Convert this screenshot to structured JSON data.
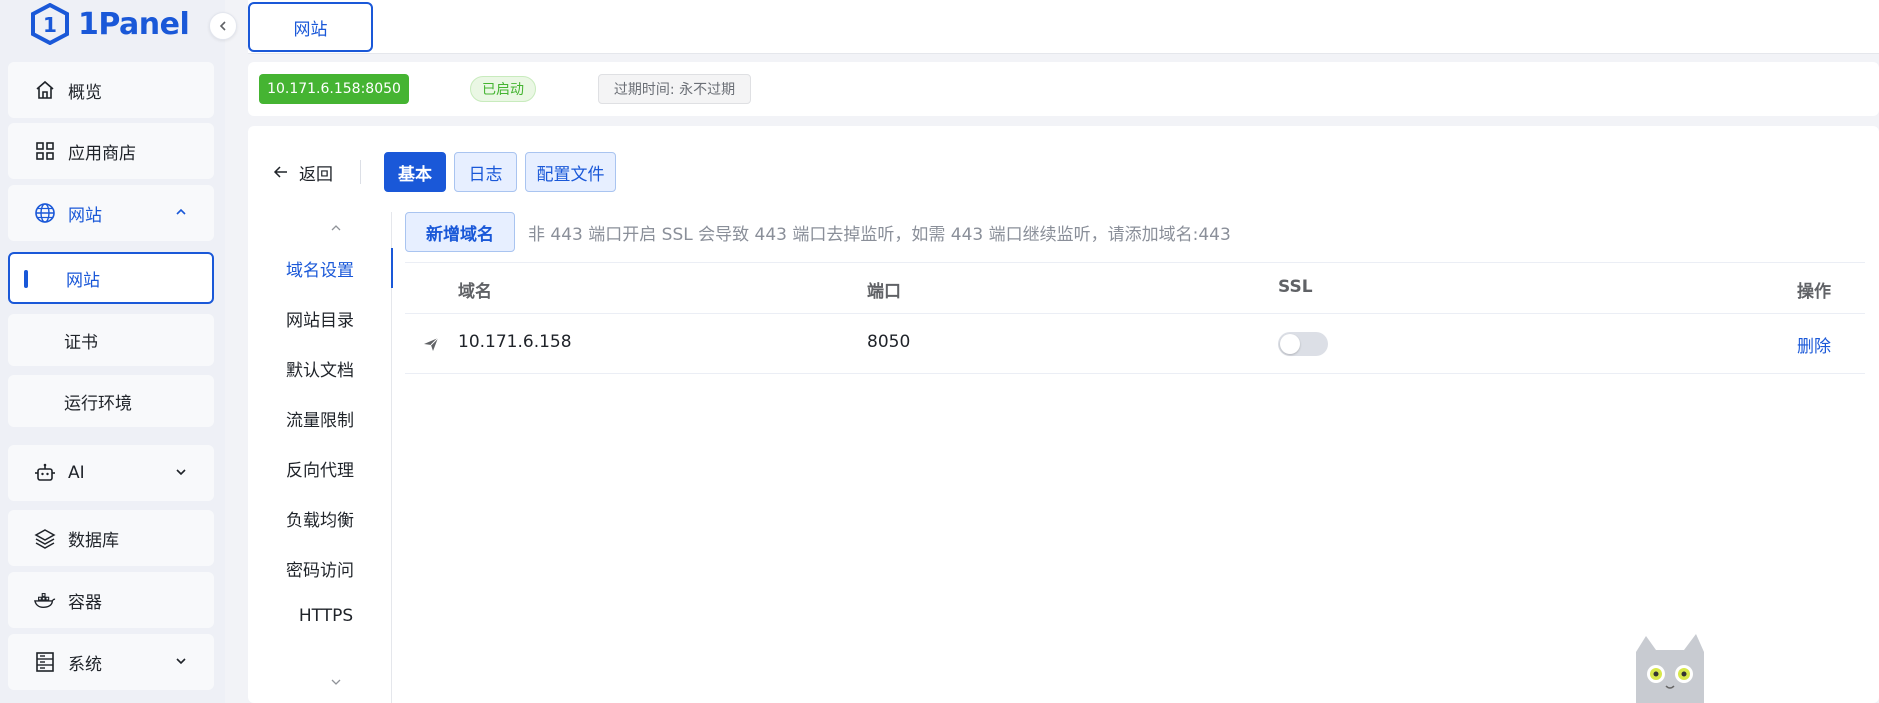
{
  "app": {
    "name": "1Panel",
    "brand_color": "#1a58d8"
  },
  "sidebar": {
    "items": [
      {
        "label": "概览",
        "icon": "home-icon"
      },
      {
        "label": "应用商店",
        "icon": "apps-grid-icon"
      },
      {
        "label": "网站",
        "icon": "globe-icon",
        "expanded": true,
        "children": [
          {
            "label": "网站",
            "active": true
          },
          {
            "label": "证书"
          },
          {
            "label": "运行环境"
          }
        ]
      },
      {
        "label": "AI",
        "icon": "robot-icon"
      },
      {
        "label": "数据库",
        "icon": "database-layers-icon"
      },
      {
        "label": "容器",
        "icon": "docker-whale-icon"
      },
      {
        "label": "系统",
        "icon": "server-icon"
      }
    ]
  },
  "tabs": {
    "active": "网站"
  },
  "site": {
    "address": "10.171.6.158:8050",
    "status": "已启动",
    "expire": "过期时间: 永不过期",
    "status_color": "#45b432"
  },
  "toolbar": {
    "back_label": "返回",
    "tabs": [
      "基本",
      "日志",
      "配置文件"
    ],
    "active_tab": "基本"
  },
  "subnav": {
    "items": [
      "域名设置",
      "网站目录",
      "默认文档",
      "流量限制",
      "反向代理",
      "负载均衡",
      "密码访问",
      "HTTPS"
    ],
    "active": "域名设置"
  },
  "domain": {
    "add_button": "新增域名",
    "hint": "非 443 端口开启 SSL 会导致 443 端口去掉监听，如需 443 端口继续监听，请添加域名:443",
    "columns": [
      "域名",
      "端口",
      "SSL",
      "操作"
    ],
    "rows": [
      {
        "domain": "10.171.6.158",
        "port": "8050",
        "ssl": false,
        "action": "删除"
      }
    ]
  }
}
